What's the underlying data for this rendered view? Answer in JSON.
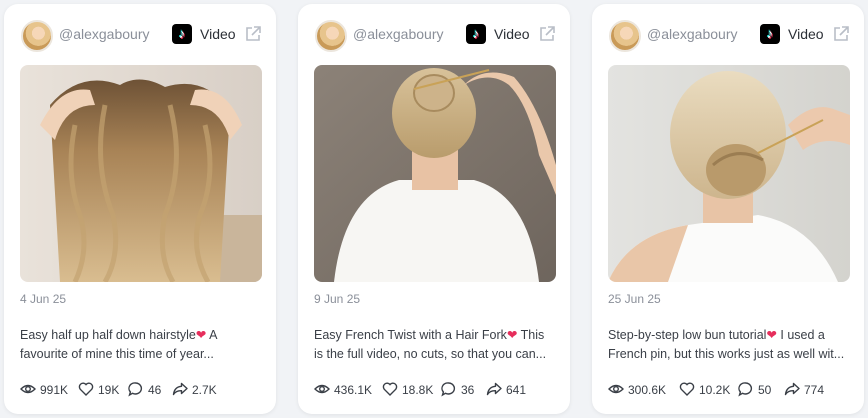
{
  "colors": {
    "page_bg": "#f1f3f6",
    "card_bg": "#ffffff",
    "muted_text": "#8a8f99",
    "body_text": "#3a3f47",
    "heart": "#e62e5c"
  },
  "icons": {
    "tiktok": "tiktok-icon",
    "external": "external-link-icon",
    "views": "eye-icon",
    "likes": "heart-outline-icon",
    "comments": "comment-icon",
    "shares": "share-icon"
  },
  "cards": [
    {
      "username": "@alexgaboury",
      "type_label": "Video",
      "date": "4 Jun 25",
      "caption": "Easy half up half down hairstyle",
      "caption_emoji": "❤",
      "caption_rest": " A favourite of mine this time of year...",
      "stats": {
        "views": "991K",
        "likes": "19K",
        "comments": "46",
        "shares": "2.7K"
      }
    },
    {
      "username": "@alexgaboury",
      "type_label": "Video",
      "date": "9 Jun 25",
      "caption": "Easy French Twist with a Hair Fork",
      "caption_emoji": "❤",
      "caption_rest": " This is the full video, no cuts, so that you can...",
      "stats": {
        "views": "436.1K",
        "likes": "18.8K",
        "comments": "36",
        "shares": "641"
      }
    },
    {
      "username": "@alexgaboury",
      "type_label": "Video",
      "date": "25 Jun 25",
      "caption": "Step-by-step low bun tutorial",
      "caption_emoji": "❤",
      "caption_rest": " I used a French pin, but this works just as well wit...",
      "stats": {
        "views": "300.6K",
        "likes": "10.2K",
        "comments": "50",
        "shares": "774"
      }
    }
  ]
}
